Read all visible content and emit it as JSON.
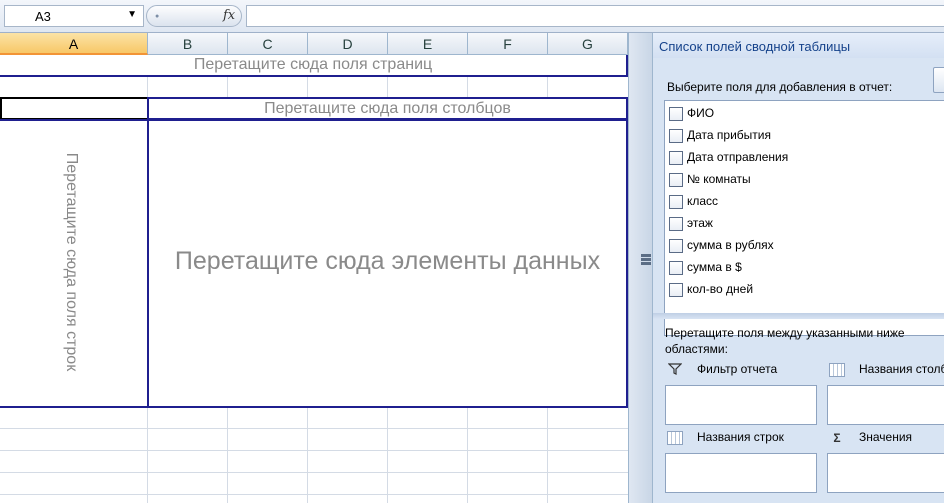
{
  "formula_bar": {
    "name_box": "A3",
    "fx": "fx",
    "formula": ""
  },
  "columns": [
    "A",
    "B",
    "C",
    "D",
    "E",
    "F",
    "G"
  ],
  "selected_column": "A",
  "pivot": {
    "page_drop": "Перетащите сюда поля страниц",
    "column_drop": "Перетащите сюда поля столбцов",
    "row_drop": "Перетащите сюда поля строк",
    "data_drop": "Перетащите сюда элементы данных"
  },
  "field_list": {
    "title": "Список полей сводной таблицы",
    "choose_label": "Выберите поля для добавления в отчет:",
    "fields": [
      {
        "label": "ФИО",
        "checked": false
      },
      {
        "label": "Дата прибытия",
        "checked": false
      },
      {
        "label": "Дата отправления",
        "checked": false
      },
      {
        "label": "№ комнаты",
        "checked": false
      },
      {
        "label": "класс",
        "checked": false
      },
      {
        "label": "этаж",
        "checked": false
      },
      {
        "label": "сумма в рублях",
        "checked": false
      },
      {
        "label": "сумма в $",
        "checked": false
      },
      {
        "label": "кол-во дней",
        "checked": false
      }
    ],
    "drag_label": "Перетащите поля между указанными ниже областями:",
    "areas": {
      "report_filter": "Фильтр отчета",
      "column_labels": "Названия столбцов",
      "row_labels": "Названия строк",
      "values": "Значения"
    },
    "icons": {
      "filter": "funnel-icon",
      "columns": "column-labels-icon",
      "rows": "row-labels-icon",
      "values": "sigma-icon"
    }
  }
}
